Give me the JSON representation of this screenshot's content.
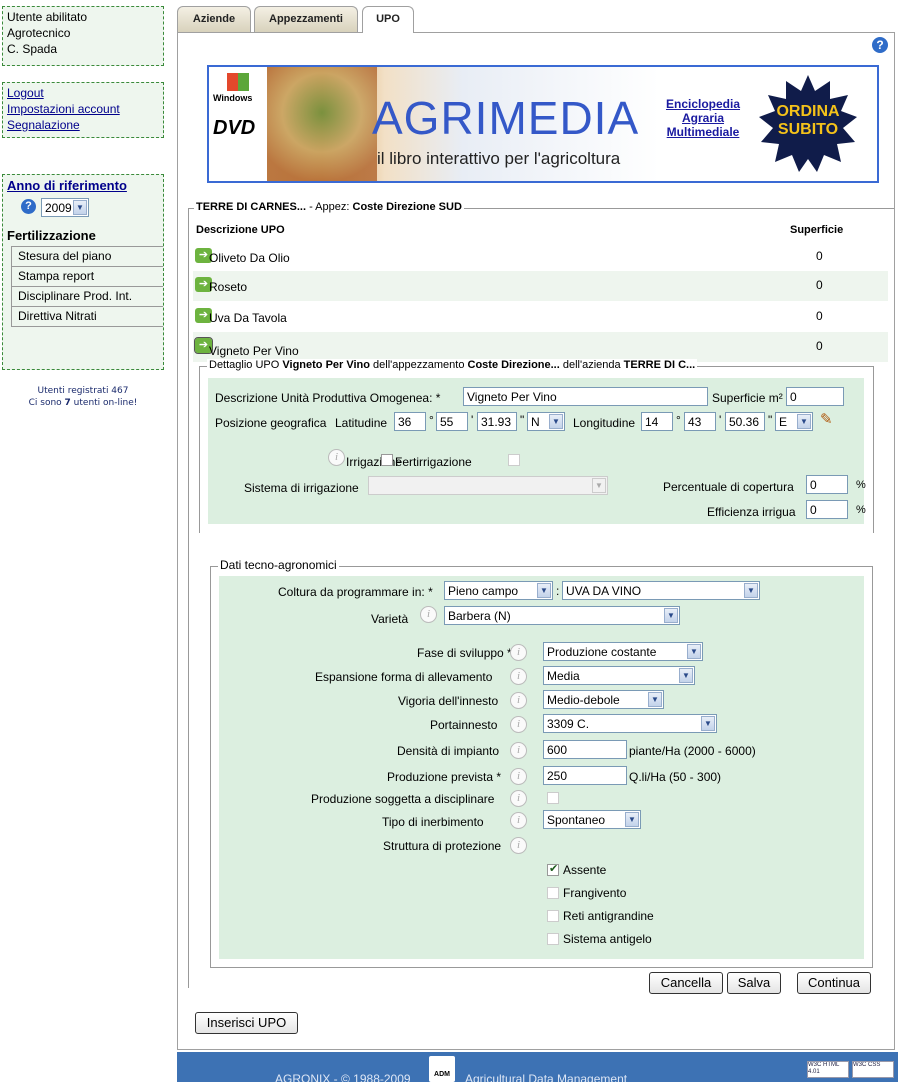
{
  "sidebar": {
    "user_box": [
      "Utente abilitato",
      "Agrotecnico",
      "C. Spada"
    ],
    "links": [
      "Logout",
      "Impostazioni account",
      "Segnalazione"
    ],
    "anno_label": "Anno di riferimento",
    "anno_value": "2009",
    "fert_label": "Fertilizzazione",
    "menu": [
      "Stesura del piano",
      "Stampa report",
      "Disciplinare Prod. Int.",
      "Direttiva Nitrati"
    ],
    "users_line1": "Utenti registrati 467",
    "users_line2_a": "Ci sono ",
    "users_line2_b": "7",
    "users_line2_c": " utenti on-line!"
  },
  "tabs": [
    "Aziende",
    "Appezzamenti",
    "UPO"
  ],
  "banner": {
    "windows": "Windows",
    "dvd": "DVD",
    "title": "AGRIMEDIA",
    "subtitle": "il libro interattivo per l'agricoltura",
    "link": "Enciclopedia Agraria Multimediale",
    "order": "ORDINA SUBITO"
  },
  "upo_list": {
    "legend_a": "TERRE DI CARNES...",
    "legend_b": " - Appez: ",
    "legend_c": "Coste Direzione SUD",
    "col_desc": "Descrizione UPO",
    "col_sup": "Superficie",
    "rows": [
      {
        "name": "Oliveto Da Olio",
        "sup": "0"
      },
      {
        "name": "Roseto",
        "sup": "0"
      },
      {
        "name": "Uva Da Tavola",
        "sup": "0"
      },
      {
        "name": "Vigneto Per Vino",
        "sup": "0"
      }
    ]
  },
  "detail": {
    "legend_a": "Dettaglio UPO ",
    "legend_b": "Vigneto Per Vino",
    "legend_c": " dell'appezzamento ",
    "legend_d": "Coste Direzione...",
    "legend_e": " dell'azienda ",
    "legend_f": "TERRE DI C...",
    "desc_label": "Descrizione Unità Produttiva Omogenea: *",
    "desc_value": "Vigneto Per Vino",
    "sup_label": "Superficie m²",
    "sup_value": "0",
    "pos_label": "Posizione geografica",
    "lat_label": "Latitudine",
    "lat": [
      "36",
      "55",
      "31.93",
      "N"
    ],
    "lon_label": "Longitudine",
    "lon": [
      "14",
      "43",
      "50.36",
      "E"
    ],
    "irr_label": "Irrigazione",
    "fert_label": "Fertirrigazione",
    "sist_label": "Sistema di irrigazione",
    "perc_label": "Percentuale di copertura",
    "perc_value": "0",
    "eff_label": "Efficienza irrigua",
    "eff_value": "0",
    "pct": "%"
  },
  "tecno": {
    "legend": "Dati tecno-agronomici",
    "coltura_label": "Coltura da programmare in: *",
    "coltura_value": "Pieno campo",
    "coltura2_value": "UVA DA VINO",
    "varieta_label": "Varietà",
    "varieta_value": "Barbera (N)",
    "fase_label": "Fase di sviluppo *",
    "fase_value": "Produzione costante",
    "esp_label": "Espansione forma di allevamento",
    "esp_value": "Media",
    "vig_label": "Vigoria dell'innesto",
    "vig_value": "Medio-debole",
    "port_label": "Portainnesto",
    "port_value": "3309 C.",
    "dens_label": "Densità di impianto",
    "dens_value": "600",
    "dens_unit": "piante/Ha (2000 - 6000)",
    "prod_label": "Produzione prevista *",
    "prod_value": "250",
    "prod_unit": "Q.li/Ha (50 - 300)",
    "disc_label": "Produzione soggetta a disciplinare",
    "inerb_label": "Tipo di inerbimento",
    "inerb_value": "Spontaneo",
    "strut_label": "Struttura di protezione",
    "options": [
      "Assente",
      "Frangivento",
      "Reti antigrandine",
      "Sistema antigelo"
    ]
  },
  "buttons": {
    "cancella": "Cancella",
    "salva": "Salva",
    "continua": "Continua",
    "inserisci": "Inserisci UPO"
  },
  "footer": {
    "text": "AGRONIX - © 1988-2009",
    "adm": "ADM",
    "tag": "Agricultural Data Management",
    "w3c_html": "W3C HTML 4.01",
    "w3c_css": "W3C CSS"
  }
}
